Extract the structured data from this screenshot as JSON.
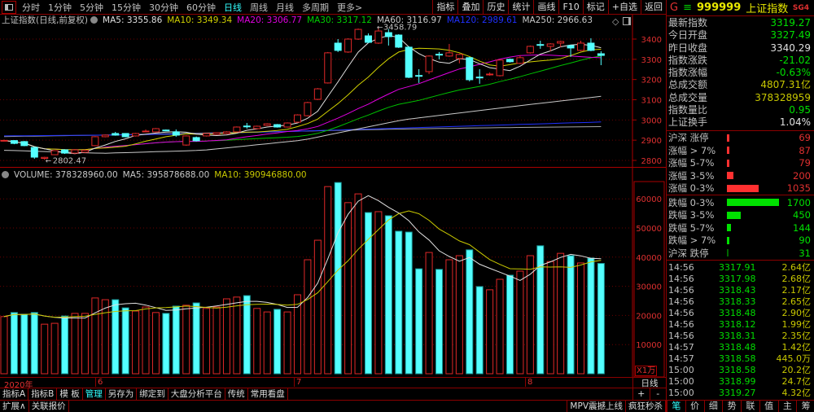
{
  "toolbar": {
    "tabs": [
      "分时",
      "1分钟",
      "5分钟",
      "15分钟",
      "30分钟",
      "60分钟",
      "日线",
      "周线",
      "月线",
      "多周期",
      "更多>"
    ],
    "active_tab": "日线",
    "right_buttons": [
      "指标",
      "叠加",
      "历史",
      "统计",
      "画线",
      "F10",
      "标记",
      "+自选",
      "返回"
    ]
  },
  "legend": {
    "title": "上证指数(日线,前复权)",
    "ma5": "MA5: 3355.86",
    "ma10": "MA10: 3349.34",
    "ma20": "MA20: 3306.77",
    "ma30": "MA30: 3317.12",
    "ma60": "MA60: 3116.97",
    "ma120": "MA120: 2989.61",
    "ma250": "MA250: 2966.63"
  },
  "volume_legend": {
    "volume": "VOLUME: 378328960.00",
    "ma5": "MA5: 395878688.00",
    "ma10": "MA10: 390946880.00"
  },
  "colors": {
    "up": "#e02828",
    "down": "#54ffff",
    "ma5": "#e0e0e0",
    "ma10": "#d0d000",
    "ma20": "#e000e0",
    "ma30": "#00c000",
    "ma60": "#c8c8c8",
    "ma120": "#2030ff",
    "ma250": "#a8a8a8"
  },
  "chart_data": [
    {
      "type": "candlestick",
      "title": "上证指数 日线",
      "y_ticks": [
        "3400",
        "3300",
        "3200",
        "3100",
        "3000",
        "2900",
        "2800"
      ],
      "ylim": [
        2770,
        3480
      ],
      "high_label": "3458.79",
      "low_label": "2802.47",
      "ohlc": [
        [
          2897,
          2899,
          2902,
          2894
        ],
        [
          2898,
          2884,
          2900,
          2880
        ],
        [
          2893,
          2873,
          2896,
          2870
        ],
        [
          2864,
          2816,
          2866,
          2808
        ],
        [
          2810,
          2815,
          2818,
          2802.47
        ],
        [
          2828,
          2848,
          2850,
          2826
        ],
        [
          2852,
          2836,
          2855,
          2832
        ],
        [
          2836,
          2852,
          2856,
          2832
        ],
        [
          2840,
          2850,
          2853,
          2837
        ],
        [
          2873,
          2917,
          2920,
          2870
        ],
        [
          2917,
          2925,
          2928,
          2914
        ],
        [
          2933,
          2925,
          2941,
          2922
        ],
        [
          2933,
          2917,
          2935,
          2914
        ],
        [
          2921,
          2933,
          2936,
          2918
        ],
        [
          2944,
          2945,
          2953,
          2940
        ],
        [
          2941,
          2957,
          2960,
          2938
        ],
        [
          2950,
          2949,
          2953,
          2946
        ],
        [
          2941,
          2925,
          2953,
          2917
        ],
        [
          2876,
          2921,
          2924,
          2872
        ],
        [
          2913,
          2897,
          2918,
          2893
        ],
        [
          2921,
          2933,
          2935,
          2918
        ],
        [
          2929,
          2937,
          2939,
          2926
        ],
        [
          2933,
          2941,
          2944,
          2930
        ],
        [
          2941,
          2965,
          2968,
          2938
        ],
        [
          2970,
          2969,
          2985,
          2957
        ],
        [
          2957,
          2969,
          2972,
          2954
        ],
        [
          2973,
          2981,
          2984,
          2970
        ],
        [
          2977,
          2965,
          2980,
          2962
        ],
        [
          2965,
          2985,
          2988,
          2962
        ],
        [
          2989,
          3025,
          3028,
          2986
        ],
        [
          3021,
          3086,
          3090,
          3018
        ],
        [
          3102,
          3154,
          3158,
          3098
        ],
        [
          3183,
          3332,
          3336,
          3180
        ],
        [
          3380,
          3344,
          3400,
          3336
        ],
        [
          3336,
          3400,
          3404,
          3332
        ],
        [
          3400,
          3448,
          3452,
          3396
        ],
        [
          3416,
          3384,
          3428,
          3380
        ],
        [
          3380,
          3440,
          3458.79,
          3376
        ],
        [
          3432,
          3412,
          3450,
          3368
        ],
        [
          3420,
          3360,
          3424,
          3356
        ],
        [
          3360,
          3211,
          3364,
          3207
        ],
        [
          3220,
          3219,
          3251,
          3183
        ],
        [
          3239,
          3316,
          3320,
          3227
        ],
        [
          3325,
          3324,
          3336,
          3300
        ],
        [
          3316,
          3332,
          3376,
          3312
        ],
        [
          3304,
          3324,
          3328,
          3280
        ],
        [
          3308,
          3199,
          3312,
          3191
        ],
        [
          3212,
          3211,
          3251,
          3179
        ],
        [
          3225,
          3227,
          3235,
          3219
        ],
        [
          3219,
          3296,
          3300,
          3215
        ],
        [
          3300,
          3288,
          3304,
          3284
        ],
        [
          3280,
          3308,
          3320,
          3276
        ],
        [
          3332,
          3364,
          3368,
          3328
        ],
        [
          3373,
          3372,
          3392,
          3352
        ],
        [
          3364,
          3376,
          3380,
          3340
        ],
        [
          3380,
          3388,
          3392,
          3360
        ],
        [
          3368,
          3356,
          3372,
          3312
        ],
        [
          3344,
          3380,
          3392,
          3340
        ],
        [
          3380,
          3344,
          3404,
          3340
        ],
        [
          3327.49,
          3319.27,
          3340,
          3271
        ]
      ],
      "ma_long": {
        "ma60": [
          2850,
          2835,
          2850,
          2900,
          3000,
          3060,
          3117
        ],
        "ma120": [
          2921,
          2925,
          2932,
          2945,
          2960,
          2975,
          2990
        ],
        "ma250": [
          2918,
          2925,
          2935,
          2945,
          2955,
          2962,
          2967
        ]
      }
    },
    {
      "type": "bar",
      "title": "VOLUME",
      "unit_label": "X1万",
      "y_ticks": [
        "60000",
        "50000",
        "40000",
        "30000",
        "20000",
        "10000"
      ],
      "ylim": [
        0,
        66000
      ],
      "values": [
        19600,
        21000,
        20400,
        21000,
        17000,
        17300,
        19800,
        20700,
        20700,
        26000,
        25400,
        25400,
        22600,
        21500,
        22900,
        21000,
        20700,
        23200,
        23500,
        24300,
        22400,
        22900,
        25700,
        26300,
        26800,
        22400,
        21200,
        22100,
        21200,
        27100,
        39100,
        45800,
        64200,
        65600,
        58700,
        61700,
        55300,
        55600,
        54200,
        48900,
        48600,
        36000,
        41600,
        35800,
        39100,
        40500,
        42500,
        29900,
        28800,
        32400,
        33800,
        35200,
        40500,
        43900,
        38500,
        41300,
        40500,
        38000,
        39700,
        37833
      ]
    }
  ],
  "xaxis": {
    "year": "2020年",
    "months": [
      "6",
      "7",
      "8"
    ],
    "period": "日线"
  },
  "bottom_toolbar": {
    "items": [
      "指标A",
      "指标B",
      "模 板",
      "管理",
      "另存为",
      "绑定到",
      "大盘分析平台",
      "传统",
      "常用看盘"
    ],
    "active": "管理",
    "plus": "+",
    "minus": "-"
  },
  "bottom_bar": {
    "left": [
      "扩展∧",
      "关联报价"
    ],
    "right": [
      "MPV震撼上线",
      "疯狂秒杀"
    ]
  },
  "panel": {
    "code": "999999",
    "name": "上证指数",
    "g": "G",
    "menu": "≡",
    "sg": "SG4",
    "info": [
      {
        "label": "最新指数",
        "value": "3319.27",
        "color": "#00e000"
      },
      {
        "label": "今日开盘",
        "value": "3327.49",
        "color": "#00e000"
      },
      {
        "label": "昨日收盘",
        "value": "3340.29",
        "color": "#e0e0e0"
      },
      {
        "label": "指数涨跌",
        "value": "-21.02",
        "color": "#00e000"
      },
      {
        "label": "指数涨幅",
        "value": "-0.63%",
        "color": "#00e000"
      },
      {
        "label": "总成交额",
        "value": "4807.31亿",
        "color": "#c8c800"
      },
      {
        "label": "总成交量",
        "value": "378328959",
        "color": "#c8c800"
      },
      {
        "label": "指数量比",
        "value": "0.95",
        "color": "#00e000"
      },
      {
        "label": "上证换手",
        "value": "1.04%",
        "color": "#e0e0e0"
      }
    ],
    "up_stats": [
      {
        "label": "沪深 涨停",
        "value": "69",
        "count": 69
      },
      {
        "label": "涨幅 > 7%",
        "value": "87",
        "count": 87
      },
      {
        "label": "涨幅 5-7%",
        "value": "79",
        "count": 79
      },
      {
        "label": "涨幅 3-5%",
        "value": "200",
        "count": 200
      },
      {
        "label": "涨幅 0-3%",
        "value": "1035",
        "count": 1035
      }
    ],
    "down_stats": [
      {
        "label": "跌幅 0-3%",
        "value": "1700",
        "count": 1700
      },
      {
        "label": "跌幅 3-5%",
        "value": "450",
        "count": 450
      },
      {
        "label": "跌幅 5-7%",
        "value": "144",
        "count": 144
      },
      {
        "label": "跌幅 > 7%",
        "value": "90",
        "count": 90
      },
      {
        "label": "沪深 跌停",
        "value": "31",
        "count": 31
      }
    ],
    "ticks": [
      {
        "time": "14:56",
        "price": "3317.91",
        "vol": "2.64亿"
      },
      {
        "time": "14:56",
        "price": "3317.98",
        "vol": "2.68亿"
      },
      {
        "time": "14:56",
        "price": "3318.43",
        "vol": "2.17亿"
      },
      {
        "time": "14:56",
        "price": "3318.33",
        "vol": "2.65亿"
      },
      {
        "time": "14:56",
        "price": "3318.48",
        "vol": "2.90亿"
      },
      {
        "time": "14:56",
        "price": "3318.12",
        "vol": "1.99亿"
      },
      {
        "time": "14:56",
        "price": "3318.31",
        "vol": "2.35亿"
      },
      {
        "time": "14:57",
        "price": "3318.48",
        "vol": "1.42亿"
      },
      {
        "time": "14:57",
        "price": "3318.58",
        "vol": "445.0万"
      },
      {
        "time": "15:00",
        "price": "3318.58",
        "vol": "20.2亿"
      },
      {
        "time": "15:00",
        "price": "3318.99",
        "vol": "24.7亿"
      },
      {
        "time": "15:00",
        "price": "3319.27",
        "vol": "4.32亿"
      }
    ],
    "tabs": [
      "笔",
      "价",
      "细",
      "势",
      "联",
      "值",
      "主",
      "筹"
    ],
    "active_tab": "笔"
  }
}
